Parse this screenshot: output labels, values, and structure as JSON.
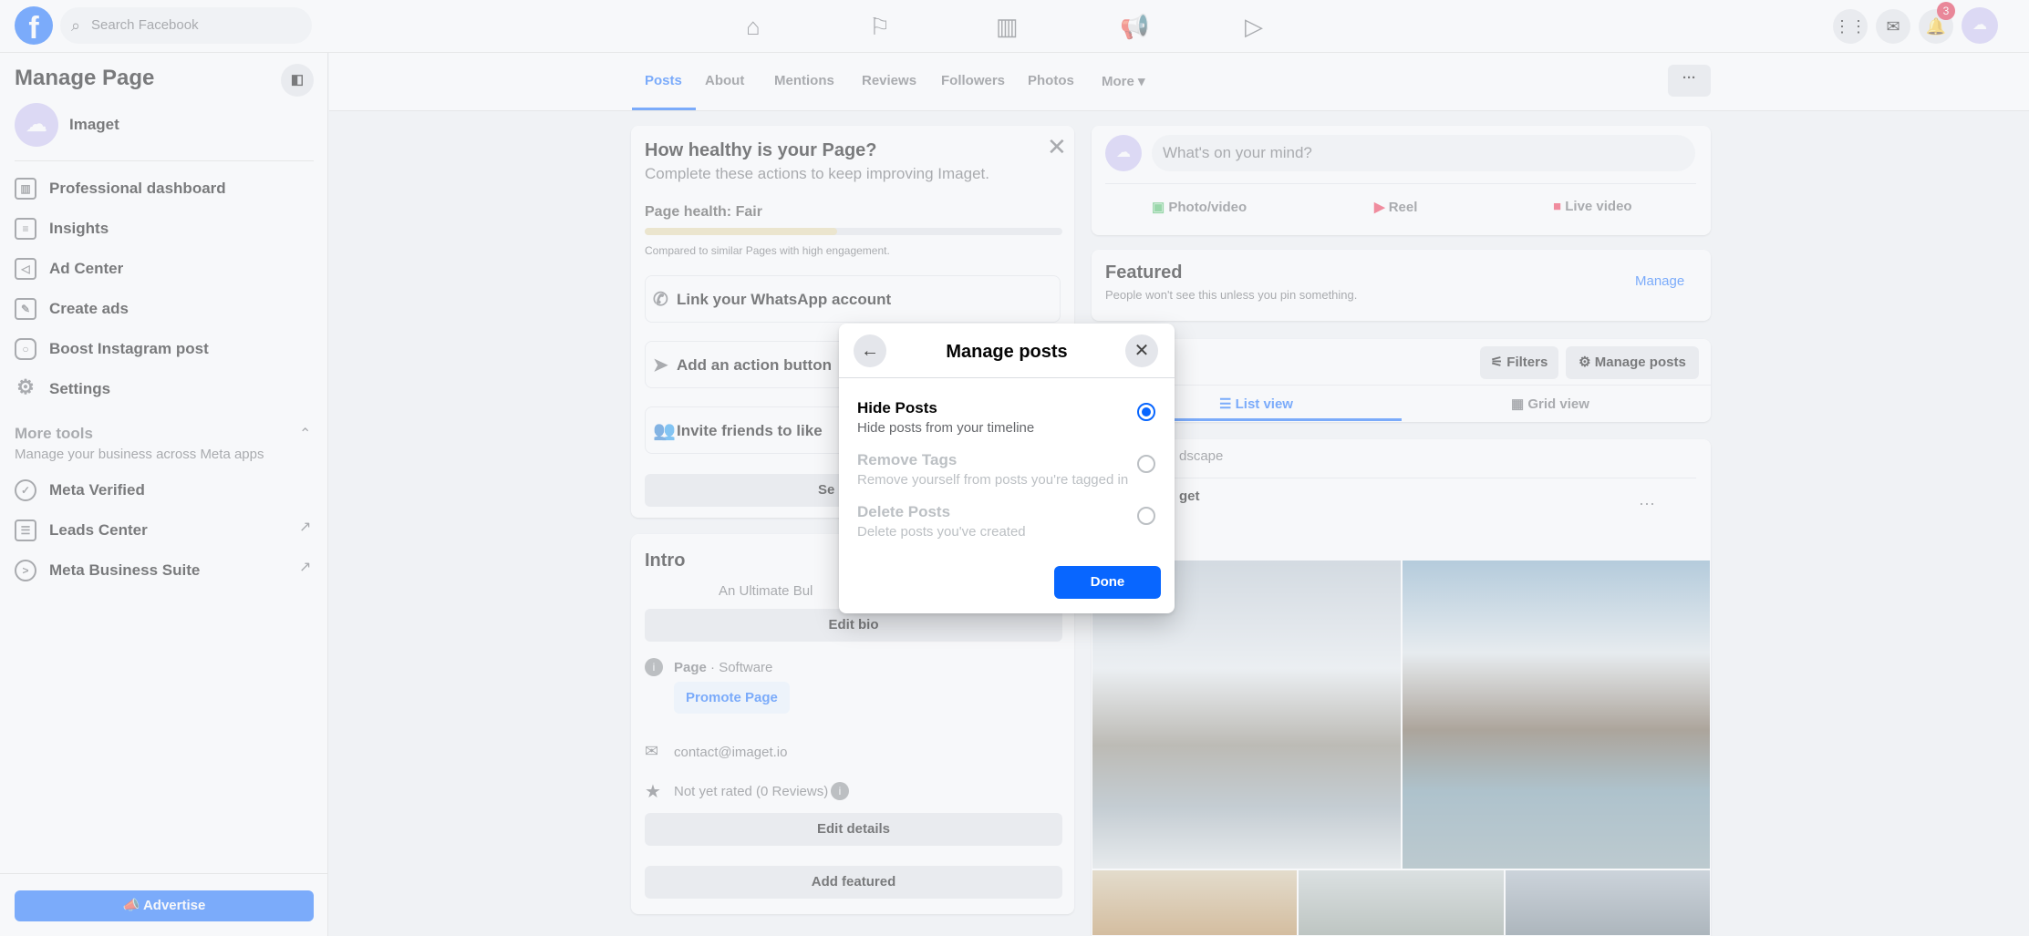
{
  "topbar": {
    "search_placeholder": "Search Facebook",
    "notifications_count": "3",
    "nav_icons": [
      "home-icon",
      "flag-icon",
      "dashboard-icon",
      "megaphone-icon",
      "video-icon"
    ]
  },
  "sidebar": {
    "title": "Manage Page",
    "page_name": "Imaget",
    "items": [
      {
        "label": "Professional dashboard",
        "icon": "dashboard-icon"
      },
      {
        "label": "Insights",
        "icon": "insights-icon"
      },
      {
        "label": "Ad Center",
        "icon": "megaphone-icon"
      },
      {
        "label": "Create ads",
        "icon": "pencil-icon"
      },
      {
        "label": "Boost Instagram post",
        "icon": "instagram-icon"
      },
      {
        "label": "Settings",
        "icon": "gear-icon"
      }
    ],
    "more_tools": {
      "title": "More tools",
      "subtitle": "Manage your business across Meta apps"
    },
    "tools": [
      {
        "label": "Meta Verified",
        "icon": "verified-icon"
      },
      {
        "label": "Leads Center",
        "icon": "leads-icon"
      },
      {
        "label": "Meta Business Suite",
        "icon": "business-suite-icon"
      }
    ],
    "advertise": "Advertise"
  },
  "tabs": [
    "Posts",
    "About",
    "Mentions",
    "Reviews",
    "Followers",
    "Photos",
    "More ▾"
  ],
  "active_tab": "Posts",
  "health": {
    "title": "How healthy is your Page?",
    "subtitle": "Complete these actions to keep improving Imaget.",
    "status": "Page health: Fair",
    "progress_percent": 46,
    "note": "Compared to similar Pages with high engagement.",
    "bar_color": "#e7d9a8",
    "tasks": [
      "Link your WhatsApp account",
      "Add an action button",
      "Invite friends to like"
    ],
    "see_all": "Se"
  },
  "intro": {
    "title": "Intro",
    "bio": "An Ultimate Bul",
    "edit_bio": "Edit bio",
    "category_bold": "Page",
    "category": " · Software",
    "promote": "Promote Page",
    "email": "contact@imaget.io",
    "rating": "Not yet rated (0 Reviews)",
    "edit_details": "Edit details",
    "add_featured": "Add featured"
  },
  "composer": {
    "placeholder": "What's on your mind?",
    "actions": [
      "Photo/video",
      "Reel",
      "Live video"
    ]
  },
  "featured": {
    "title": "Featured",
    "subtitle": "People won't see this unless you pin something.",
    "manage": "Manage"
  },
  "posts_bar": {
    "filters": "Filters",
    "manage_posts": "Manage posts",
    "list_view": "List view",
    "grid_view": "Grid view"
  },
  "post": {
    "title_fragment": "dscape",
    "author_fragment": "get"
  },
  "modal": {
    "title": "Manage posts",
    "options": [
      {
        "title": "Hide Posts",
        "desc": "Hide posts from your timeline",
        "selected": true
      },
      {
        "title": "Remove Tags",
        "desc": "Remove yourself from posts you're tagged in",
        "selected": false
      },
      {
        "title": "Delete Posts",
        "desc": "Delete posts you've created",
        "selected": false
      }
    ],
    "done": "Done",
    "accent": "#0866ff"
  }
}
